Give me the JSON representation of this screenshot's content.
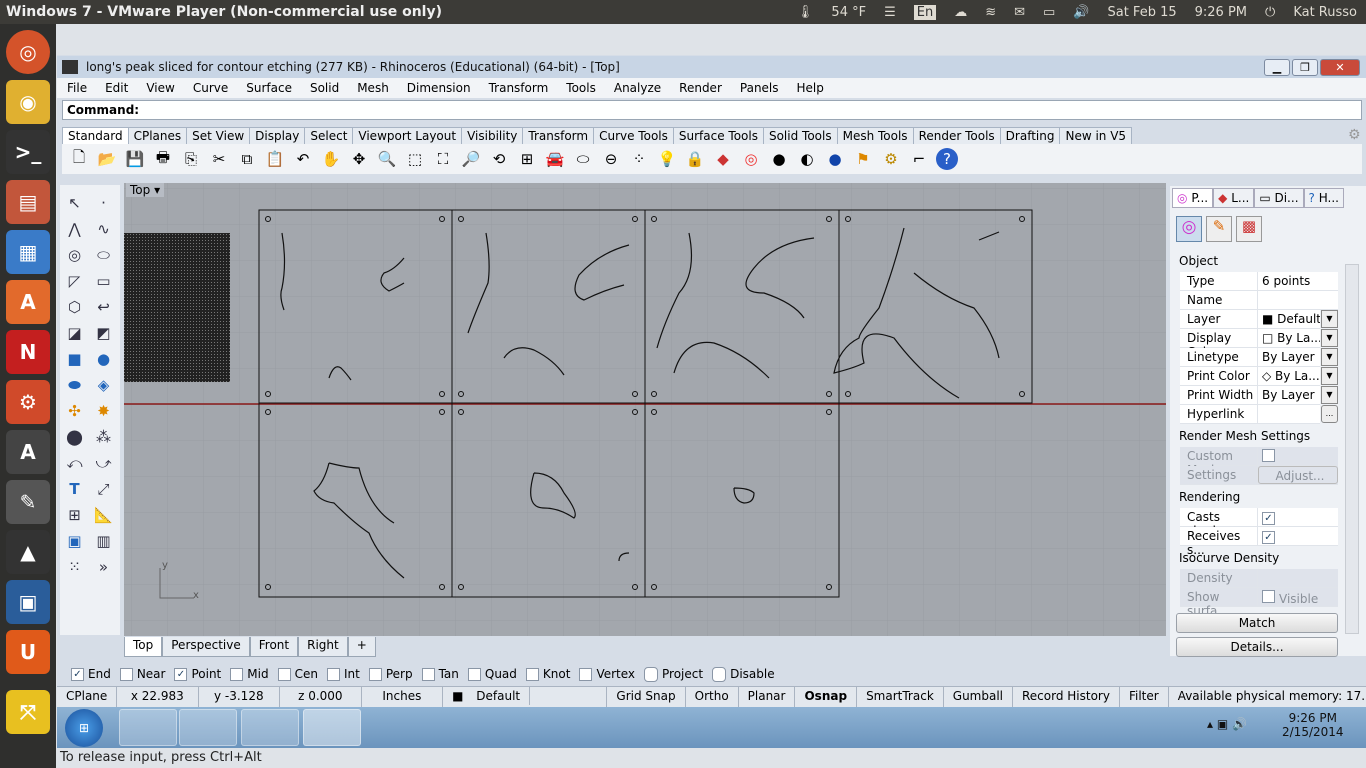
{
  "ubuntu_bar": {
    "title": "Windows 7 - VMware Player (Non-commercial use only)",
    "temperature": "54 °F",
    "keyboard": "En",
    "date": "Sat Feb 15",
    "time": "9:26 PM",
    "user": "Kat Russo"
  },
  "window": {
    "title": "long's peak sliced for contour etching (277 KB) - Rhinoceros (Educational) (64-bit) - [Top]"
  },
  "menu": [
    "File",
    "Edit",
    "View",
    "Curve",
    "Surface",
    "Solid",
    "Mesh",
    "Dimension",
    "Transform",
    "Tools",
    "Analyze",
    "Render",
    "Panels",
    "Help"
  ],
  "command": {
    "label": "Command:",
    "value": ""
  },
  "toolbar_tabs": [
    "Standard",
    "CPlanes",
    "Set View",
    "Display",
    "Select",
    "Viewport Layout",
    "Visibility",
    "Transform",
    "Curve Tools",
    "Surface Tools",
    "Solid Tools",
    "Mesh Tools",
    "Render Tools",
    "Drafting",
    "New in V5"
  ],
  "viewport": {
    "name": "Top",
    "axis_y": "y",
    "axis_x": "x"
  },
  "viewport_tabs": [
    "Top",
    "Perspective",
    "Front",
    "Right"
  ],
  "properties": {
    "tabs": [
      "P...",
      "L...",
      "Di...",
      "H..."
    ],
    "sections": {
      "object": "Object",
      "render_mesh": "Render Mesh Settings",
      "rendering": "Rendering",
      "isocurve": "Isocurve Density"
    },
    "rows": [
      {
        "k": "Type",
        "v": "6 points"
      },
      {
        "k": "Name",
        "v": ""
      },
      {
        "k": "Layer",
        "v": "Default"
      },
      {
        "k": "Display Color",
        "v": "By La..."
      },
      {
        "k": "Linetype",
        "v": "By Layer"
      },
      {
        "k": "Print Color",
        "v": "By La..."
      },
      {
        "k": "Print Width",
        "v": "By Layer"
      },
      {
        "k": "Hyperlink",
        "v": "..."
      }
    ],
    "custom_mesh": "Custom Mesh",
    "settings": "Settings",
    "adjust": "Adjust...",
    "casts": "Casts shado...",
    "receives": "Receives s...",
    "density": "Density",
    "show_surface": "Show surfa...",
    "visible": "Visible",
    "match": "Match",
    "details": "Details..."
  },
  "osnap": [
    {
      "l": "End",
      "c": true
    },
    {
      "l": "Near",
      "c": false
    },
    {
      "l": "Point",
      "c": true
    },
    {
      "l": "Mid",
      "c": false
    },
    {
      "l": "Cen",
      "c": false
    },
    {
      "l": "Int",
      "c": false
    },
    {
      "l": "Perp",
      "c": false
    },
    {
      "l": "Tan",
      "c": false
    },
    {
      "l": "Quad",
      "c": false
    },
    {
      "l": "Knot",
      "c": false
    },
    {
      "l": "Vertex",
      "c": false
    },
    {
      "l": "Project",
      "c": false
    },
    {
      "l": "Disable",
      "c": false
    }
  ],
  "status": {
    "cplane": "CPlane",
    "x": "x 22.983",
    "y": "y -3.128",
    "z": "z 0.000",
    "units": "Inches",
    "layer": "Default",
    "grid_snap": "Grid Snap",
    "ortho": "Ortho",
    "planar": "Planar",
    "osnap": "Osnap",
    "smarttrack": "SmartTrack",
    "gumball": "Gumball",
    "record_history": "Record History",
    "filter": "Filter",
    "memory": "Available physical memory: 17..."
  },
  "taskbar": {
    "time": "9:26 PM",
    "date": "2/15/2014"
  },
  "footer": "To release input, press Ctrl+Alt"
}
